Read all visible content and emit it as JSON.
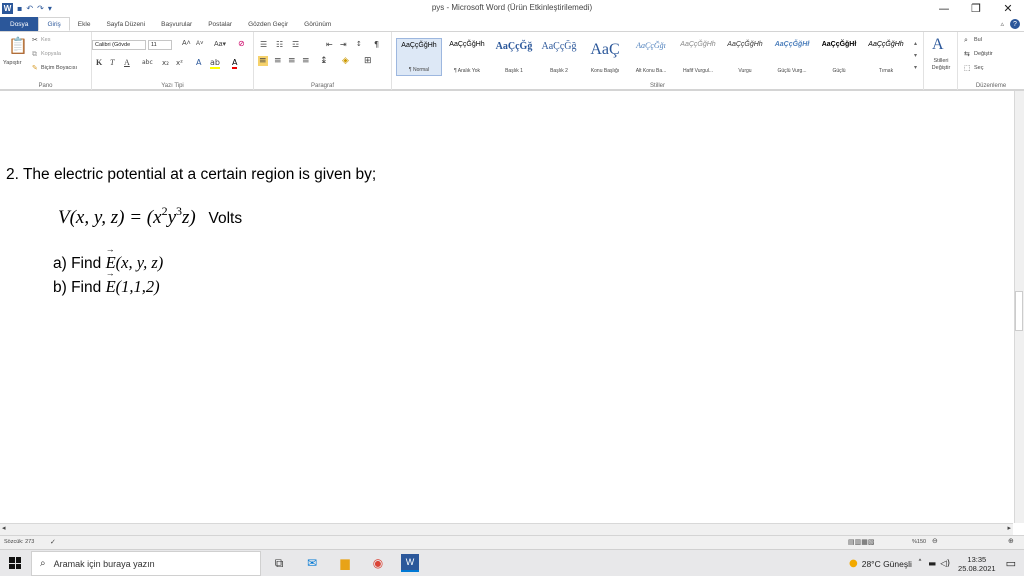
{
  "window": {
    "title": "pys - Microsoft Word (Ürün Etkinleştirilemedi)",
    "minimize": "—",
    "maximize": "❐",
    "close": "✕"
  },
  "tabs": [
    "Dosya",
    "Giriş",
    "Ekle",
    "Sayfa Düzeni",
    "Başvurular",
    "Postalar",
    "Gözden Geçir",
    "Görünüm"
  ],
  "ribbon": {
    "clipboard": {
      "label": "Pano",
      "paste": "Yapıştır",
      "cut": "Kes",
      "copy": "Kopyala",
      "format_painter": "Biçim Boyacısı"
    },
    "font": {
      "label": "Yazı Tipi",
      "name": "Calibri (Gövde",
      "size": "11"
    },
    "paragraph": {
      "label": "Paragraf"
    },
    "styles": {
      "label": "Stiller",
      "items": [
        {
          "sample": "AaÇçĞğHh",
          "name": "¶ Normal"
        },
        {
          "sample": "AaÇçĞğHh",
          "name": "¶ Aralık Yok"
        },
        {
          "sample": "AaÇçĞğ",
          "name": "Başlık 1"
        },
        {
          "sample": "AaÇçĞğ",
          "name": "Başlık 2"
        },
        {
          "sample": "AaÇ",
          "name": "Konu Başlığı"
        },
        {
          "sample": "AaÇçĞğı",
          "name": "Alt Konu Ba..."
        },
        {
          "sample": "AaÇçĞğHh",
          "name": "Hafif Vurgul..."
        },
        {
          "sample": "AaÇçĞğHh",
          "name": "Vurgu"
        },
        {
          "sample": "AaÇçĞğHł",
          "name": "Güçlü Vurg..."
        },
        {
          "sample": "AaÇçĞğHł",
          "name": "Güçlü"
        },
        {
          "sample": "AaÇçĞğHh",
          "name": "Tırnak"
        }
      ],
      "change_styles": "Stilleri Değiştir"
    },
    "editing": {
      "label": "Düzenleme",
      "find": "Bul",
      "replace": "Değiştir",
      "select": "Seç"
    }
  },
  "document": {
    "question": "2. The electric potential at a certain region is given by;",
    "equation_lhs": "V(x, y, z) = (x",
    "equation_exp1": "2",
    "equation_y": "y",
    "equation_exp2": "3",
    "equation_rhs": "z)",
    "equation_unit": "Volts",
    "part_a_label": "a)  Find",
    "part_a_vec": "E",
    "part_a_args": "(x, y, z)",
    "part_b_label": "b)  Find",
    "part_b_vec": "E",
    "part_b_args": "(1,1,2)"
  },
  "status": {
    "word_count": "Sözcük: 273",
    "zoom": "%150"
  },
  "taskbar": {
    "search_placeholder": "Aramak için buraya yazın",
    "weather": "28°C  Güneşli",
    "time": "13:35",
    "date": "25.08.2021"
  },
  "colors": {
    "accent": "#2b579a"
  }
}
